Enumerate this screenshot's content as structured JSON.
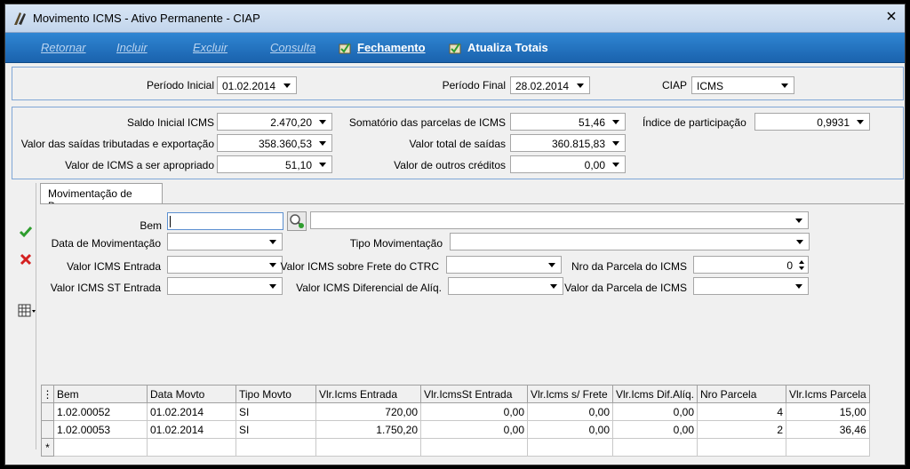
{
  "window": {
    "title": "Movimento ICMS - Ativo Permanente - CIAP"
  },
  "menu": {
    "retornar": "Retornar",
    "incluir": "Incluir",
    "excluir": "Excluir",
    "consulta": "Consulta",
    "fechamento": "Fechamento",
    "atualiza_totais": "Atualiza Totais"
  },
  "filters": {
    "periodo_inicial_label": "Período Inicial",
    "periodo_inicial_value": "01.02.2014",
    "periodo_final_label": "Período Final",
    "periodo_final_value": "28.02.2014",
    "ciap_label": "CIAP",
    "ciap_value": "ICMS"
  },
  "totals": {
    "saldo_inicial_label": "Saldo Inicial ICMS",
    "saldo_inicial_value": "2.470,20",
    "valor_saidas_trib_label": "Valor das saídas tributadas e exportação",
    "valor_saidas_trib_value": "358.360,53",
    "valor_icms_apropriado_label": "Valor de ICMS a ser apropriado",
    "valor_icms_apropriado_value": "51,10",
    "somatorio_label": "Somatório das parcelas de ICMS",
    "somatorio_value": "51,46",
    "valor_total_saidas_label": "Valor total de saídas",
    "valor_total_saidas_value": "360.815,83",
    "valor_outros_creditos_label": "Valor de outros créditos",
    "valor_outros_creditos_value": "0,00",
    "indice_label": "Índice de participação",
    "indice_value": "0,9931"
  },
  "tab": {
    "label": "Movimentação de Bens"
  },
  "form": {
    "bem_label": "Bem",
    "bem_value": "",
    "bem_desc_value": "",
    "data_mov_label": "Data de Movimentação",
    "data_mov_value": "",
    "tipo_mov_label": "Tipo Movimentação",
    "tipo_mov_value": "",
    "vlr_icms_entrada_label": "Valor ICMS Entrada",
    "vlr_icms_entrada_value": "",
    "vlr_icms_frete_label": "Valor ICMS sobre Frete do CTRC",
    "vlr_icms_frete_value": "",
    "nro_parcela_label": "Nro da Parcela do ICMS",
    "nro_parcela_value": "0",
    "vlr_icms_st_label": "Valor ICMS ST Entrada",
    "vlr_icms_st_value": "",
    "vlr_icms_dif_label": "Valor ICMS Diferencial de Alíq.",
    "vlr_icms_dif_value": "",
    "vlr_parcela_label": "Valor da Parcela de ICMS",
    "vlr_parcela_value": ""
  },
  "grid": {
    "columns": [
      "Bem",
      "Data Movto",
      "Tipo Movto",
      "Vlr.Icms Entrada",
      "Vlr.IcmsSt Entrada",
      "Vlr.Icms s/ Frete",
      "Vlr.Icms Dif.Alíq.",
      "Nro Parcela",
      "Vlr.Icms Parcela"
    ],
    "rows": [
      [
        "1.02.00052",
        "01.02.2014",
        "SI",
        "720,00",
        "0,00",
        "0,00",
        "0,00",
        "4",
        "15,00"
      ],
      [
        "1.02.00053",
        "01.02.2014",
        "SI",
        "1.750,20",
        "0,00",
        "0,00",
        "0,00",
        "2",
        "36,46"
      ]
    ],
    "new_row_marker": "*"
  },
  "colors": {
    "menubar": "#1f6fbf",
    "panel_border": "#7fa6d6",
    "confirm": "#2e9d2e",
    "cancel": "#d42020"
  }
}
